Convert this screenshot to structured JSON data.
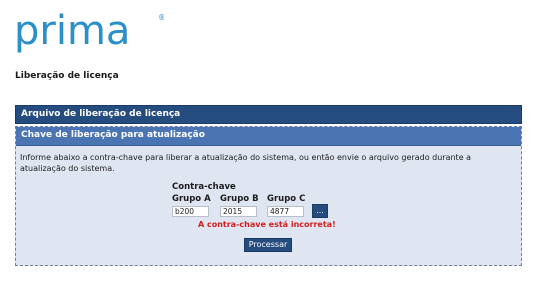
{
  "brand": {
    "logo_text": "prima",
    "logo_mark": "®",
    "color": "#2a8fcb"
  },
  "page": {
    "title": "Liberação de licença"
  },
  "sections": {
    "file_section_label": "Arquivo de liberação de licença",
    "key_section_label": "Chave de liberação para atualização"
  },
  "form": {
    "description": "Informe abaixo a contra-chave para liberar a atualização do sistema, ou então envie o arquivo gerado durante a atualização do sistema.",
    "contra_chave_label": "Contra-chave",
    "groups": [
      {
        "label": "Grupo A",
        "value": "b200"
      },
      {
        "label": "Grupo B",
        "value": "2015"
      },
      {
        "label": "Grupo C",
        "value": "4877"
      }
    ],
    "more_button_label": "...",
    "error_message": "A contra-chave está incorreta!",
    "submit_label": "Processar"
  }
}
